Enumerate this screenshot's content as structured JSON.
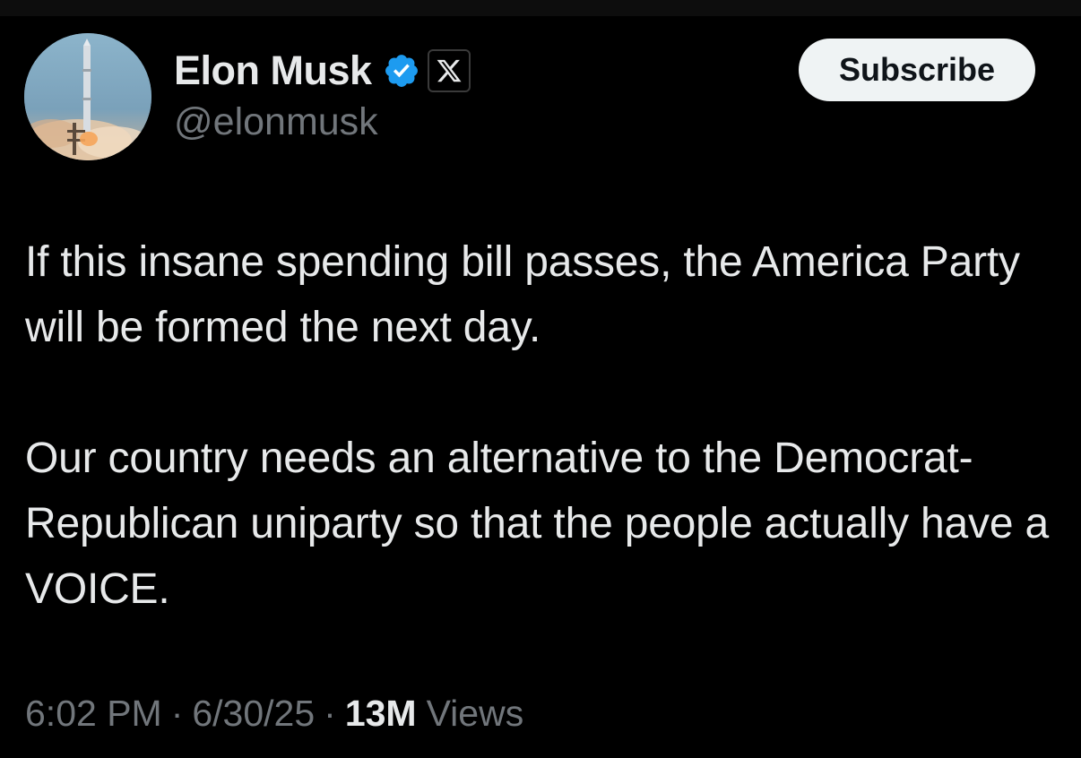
{
  "author": {
    "display_name": "Elon Musk",
    "handle": "@elonmusk",
    "verified_badge_icon": "verified-check-icon",
    "verified_color": "#1d9bf0",
    "affiliation_icon": "x-logo-icon",
    "avatar_icon": "rocket-launch-avatar"
  },
  "actions": {
    "subscribe_label": "Subscribe"
  },
  "tweet": {
    "paragraphs": [
      "If this insane spending bill passes, the America Party will be formed the next day.",
      "Our country needs an alternative to the Democrat-Republican uniparty so that the people actually have a VOICE."
    ]
  },
  "meta": {
    "time": "6:02 PM",
    "separator": "·",
    "date": "6/30/25",
    "views_count": "13M",
    "views_label": "Views"
  },
  "colors": {
    "background": "#000000",
    "text_primary": "#e7e9ea",
    "text_secondary": "#71767b",
    "button_bg": "#eff3f4"
  }
}
